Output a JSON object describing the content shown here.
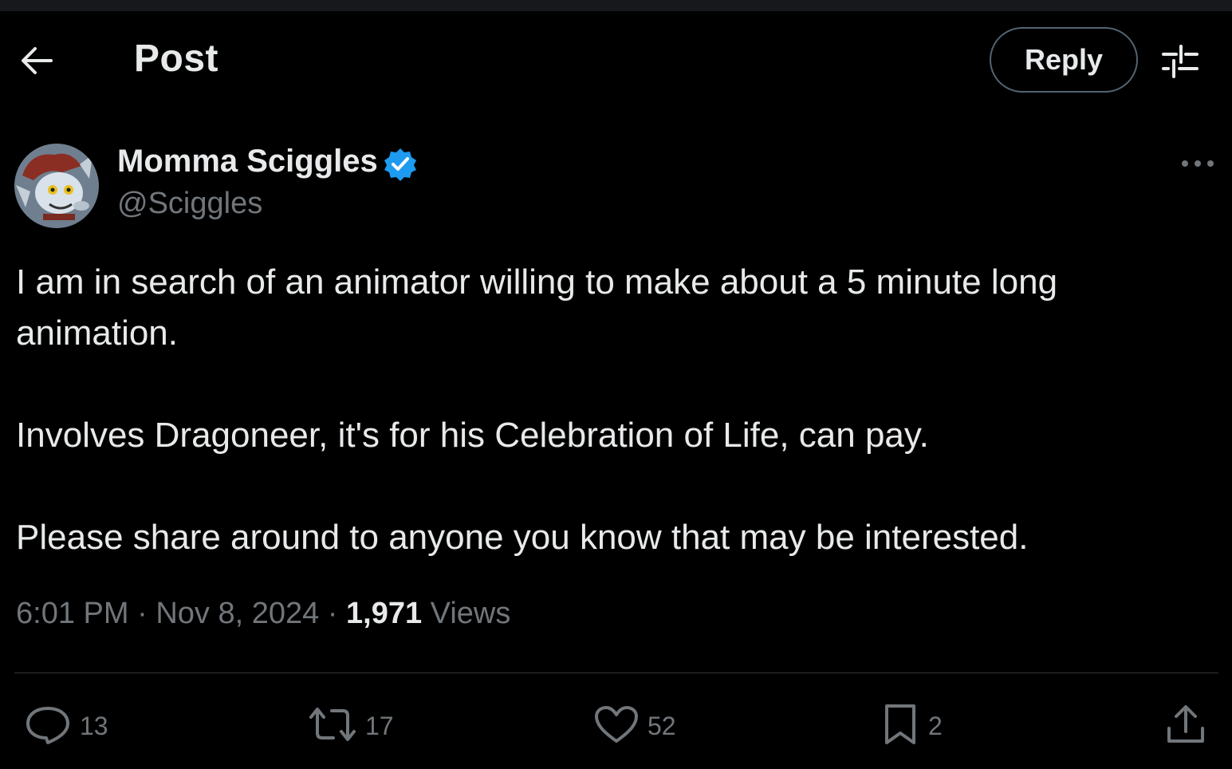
{
  "header": {
    "title": "Post",
    "reply_label": "Reply"
  },
  "author": {
    "display_name": "Momma Sciggles",
    "handle": "@Sciggles",
    "verified": true
  },
  "post": {
    "paragraphs": [
      "I am in search of an animator willing to make about a 5 minute long animation.",
      "Involves Dragoneer, it's for his Celebration of Life, can pay.",
      "Please share around to anyone you know that may be interested."
    ],
    "time": "6:01 PM",
    "date": "Nov 8, 2024",
    "separator": "·",
    "views_count": "1,971",
    "views_label": "Views"
  },
  "actions": {
    "replies": "13",
    "reposts": "17",
    "likes": "52",
    "bookmarks": "2"
  },
  "colors": {
    "background": "#000000",
    "text": "#e7e9ea",
    "secondary": "#71767b",
    "verified": "#1d9bf0",
    "divider": "#2f3336"
  }
}
